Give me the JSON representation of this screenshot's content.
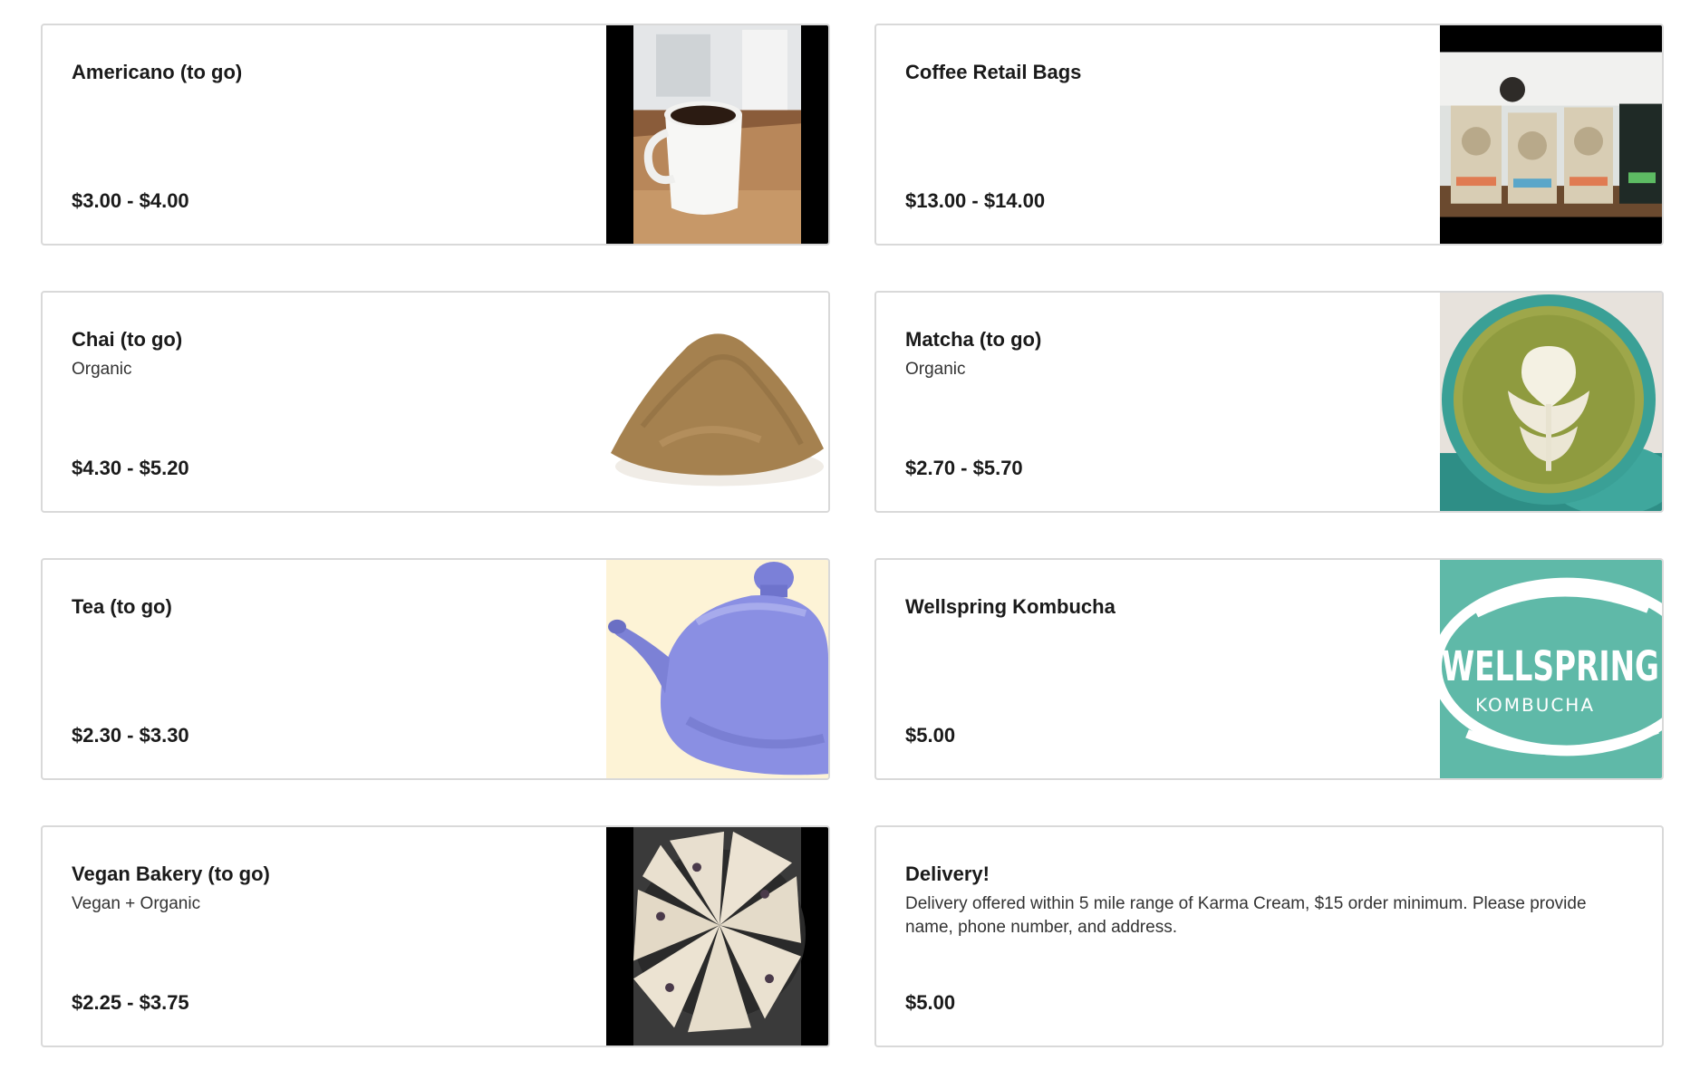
{
  "products": [
    {
      "name": "Americano (to go)",
      "description": "",
      "price": "$3.00 - $4.00",
      "image": "coffee-mug-photo"
    },
    {
      "name": "Coffee Retail Bags",
      "description": "",
      "price": "$13.00 - $14.00",
      "image": "coffee-bags-photo"
    },
    {
      "name": "Chai (to go)",
      "description": "Organic",
      "price": "$4.30 - $5.20",
      "image": "chai-powder-photo"
    },
    {
      "name": "Matcha (to go)",
      "description": "Organic",
      "price": "$2.70 - $5.70",
      "image": "matcha-latte-photo"
    },
    {
      "name": "Tea (to go)",
      "description": "",
      "price": "$2.30 - $3.30",
      "image": "teapot-photo"
    },
    {
      "name": "Wellspring Kombucha",
      "description": "",
      "price": "$5.00",
      "image": "wellspring-logo",
      "logo_text": "WELLSPRING",
      "logo_subtext": "KOMBUCHA"
    },
    {
      "name": "Vegan Bakery (to go)",
      "description": "Vegan + Organic",
      "price": "$2.25 - $3.75",
      "image": "scones-photo"
    },
    {
      "name": "Delivery!",
      "description": "Delivery offered within 5 mile range of Karma Cream, $15 order minimum. Please provide name, phone number, and address.",
      "price": "$5.00"
    }
  ]
}
